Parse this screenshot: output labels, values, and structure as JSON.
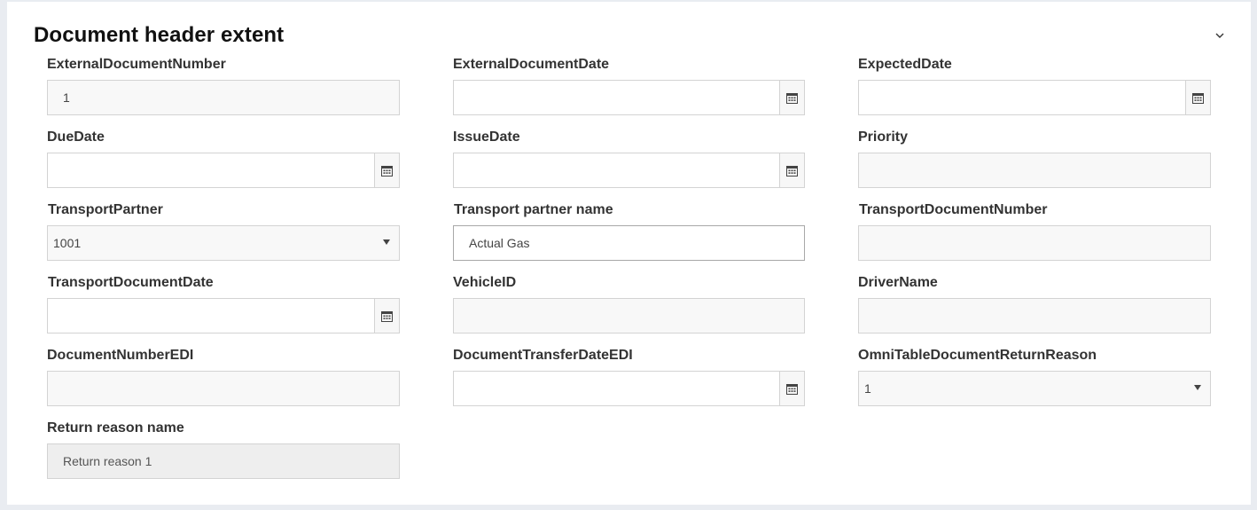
{
  "section": {
    "title": "Document header extent"
  },
  "fields": {
    "external_document_number": {
      "label": "ExternalDocumentNumber",
      "value": "1"
    },
    "external_document_date": {
      "label": "ExternalDocumentDate",
      "value": ""
    },
    "expected_date": {
      "label": "ExpectedDate",
      "value": ""
    },
    "due_date": {
      "label": "DueDate",
      "value": ""
    },
    "issue_date": {
      "label": "IssueDate",
      "value": ""
    },
    "priority": {
      "label": "Priority",
      "value": ""
    },
    "transport_partner": {
      "label": "TransportPartner",
      "value": "1001"
    },
    "transport_partner_name": {
      "label": "Transport partner name",
      "value": "Actual Gas"
    },
    "transport_document_number": {
      "label": "TransportDocumentNumber",
      "value": ""
    },
    "transport_document_date": {
      "label": "TransportDocumentDate",
      "value": ""
    },
    "vehicle_id": {
      "label": "VehicleID",
      "value": ""
    },
    "driver_name": {
      "label": "DriverName",
      "value": ""
    },
    "document_number_edi": {
      "label": "DocumentNumberEDI",
      "value": ""
    },
    "document_transfer_date_edi": {
      "label": "DocumentTransferDateEDI",
      "value": ""
    },
    "return_reason": {
      "label": "OmniTableDocumentReturnReason",
      "value": "1"
    },
    "return_reason_name": {
      "label": "Return reason name",
      "value": "Return reason 1"
    }
  },
  "icons": {
    "collapse": "chevron-down-icon",
    "date_picker": "calendar-icon",
    "dropdown": "dropdown-caret-icon"
  }
}
